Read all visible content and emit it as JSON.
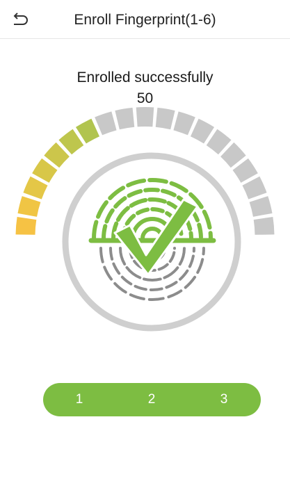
{
  "header": {
    "title": "Enroll Fingerprint(1-6)",
    "back_icon": "back-arrow-icon"
  },
  "status": {
    "message": "Enrolled successfully",
    "quality": "50"
  },
  "gauge": {
    "total_segments": 19,
    "filled_segments": 7,
    "fill_colors": [
      "#f6c244",
      "#f0c544",
      "#e4c747",
      "#d8c748",
      "#ccc64b",
      "#bec64d",
      "#b1c44f"
    ],
    "empty_color": "#c8c8c8"
  },
  "fingerprint": {
    "icon": "fingerprint-icon",
    "check_icon": "checkmark-icon",
    "green": "#7dbd42",
    "gray": "#8c8c8c"
  },
  "steps": {
    "labels": [
      "1",
      "2",
      "3"
    ],
    "color": "#7dbd42"
  }
}
